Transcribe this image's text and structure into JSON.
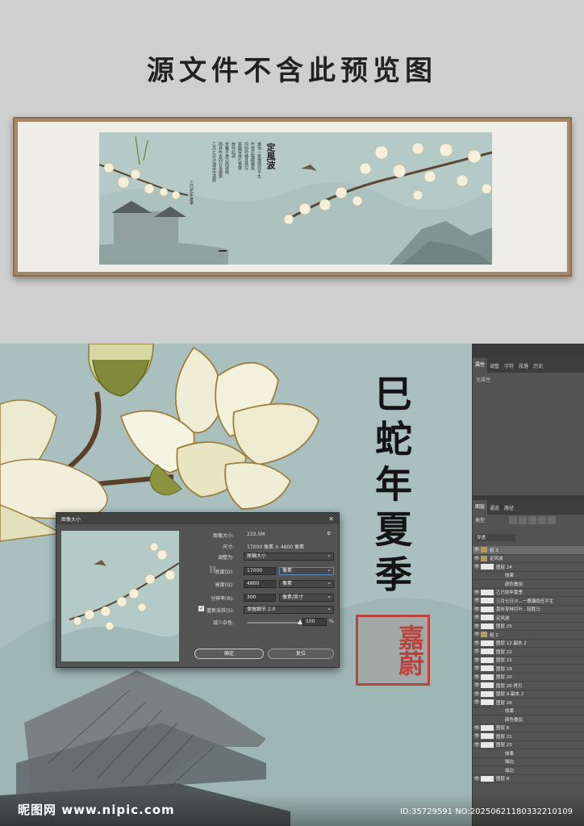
{
  "top": {
    "title": "源文件不含此预览图",
    "poem_title": "定風波",
    "poem_cols": [
      "乙巳蛇年夏季",
      "三月七日沙湖道中遇雨",
      "雨具先去同行皆狼狽",
      "余獨不覺已而遂晴",
      "故作此詞",
      "莫聽穿林打葉聲",
      "何妨吟嘯且徐行",
      "竹杖芒鞋輕勝馬",
      "誰怕一蓑煙雨任平生"
    ]
  },
  "canvas": {
    "calligraphy": "巳蛇年夏季",
    "seal": "嘉蔚"
  },
  "properties_panel": {
    "tabs": [
      "属性",
      "调整",
      "字符",
      "段落",
      "历史"
    ],
    "no_properties": "无属性"
  },
  "layers_panel": {
    "tabs": [
      "图层",
      "通道",
      "路径"
    ],
    "search_placeholder": "类型",
    "blend_mode": "穿透",
    "layers": [
      {
        "name": "组 3",
        "type": "group",
        "selected": true
      },
      {
        "name": "定风波",
        "type": "group"
      },
      {
        "name": "图层 24",
        "type": "layer"
      },
      {
        "name": "效果",
        "type": "fx"
      },
      {
        "name": "颜色叠加",
        "type": "fx"
      },
      {
        "name": "乙巳蛇年夏季",
        "type": "layer"
      },
      {
        "name": "三月七日沙...一蓑烟雨任平生",
        "type": "layer"
      },
      {
        "name": "莫听穿林打叶...轻胜马",
        "type": "layer"
      },
      {
        "name": "定风波",
        "type": "layer"
      },
      {
        "name": "图层 25",
        "type": "layer"
      },
      {
        "name": "组 2",
        "type": "group"
      },
      {
        "name": "图层 12 副本 2",
        "type": "layer"
      },
      {
        "name": "图层 22",
        "type": "layer"
      },
      {
        "name": "图层 15",
        "type": "layer"
      },
      {
        "name": "图层 19",
        "type": "layer"
      },
      {
        "name": "图层 20",
        "type": "layer"
      },
      {
        "name": "图层 20 拷贝",
        "type": "layer"
      },
      {
        "name": "图层 9 副本 2",
        "type": "layer"
      },
      {
        "name": "图层 26",
        "type": "layer"
      },
      {
        "name": "效果",
        "type": "fx"
      },
      {
        "name": "颜色叠加",
        "type": "fx"
      },
      {
        "name": "图层 8",
        "type": "layer"
      },
      {
        "name": "图层 21",
        "type": "layer"
      },
      {
        "name": "图层 23",
        "type": "layer"
      },
      {
        "name": "效果",
        "type": "fx"
      },
      {
        "name": "描边",
        "type": "fx"
      },
      {
        "name": "描边",
        "type": "fx"
      },
      {
        "name": "图层 8",
        "type": "layer"
      }
    ]
  },
  "dialog": {
    "title": "图像大小",
    "image_size_label": "图像大小:",
    "image_size_value": "233.5M",
    "dimensions_label": "尺寸:",
    "dimensions_value": "17000 像素 × 4800 像素",
    "fit_label": "调整为:",
    "fit_value": "原稿大小",
    "width_label": "宽度(D):",
    "width_value": "17000",
    "width_unit": "像素",
    "height_label": "高度(G):",
    "height_value": "4800",
    "height_unit": "像素",
    "resolution_label": "分辨率(R):",
    "resolution_value": "300",
    "resolution_unit": "像素/英寸",
    "resample_label": "重新采样(S):",
    "resample_value": "保留细节 2.0",
    "noise_label": "减少杂色:",
    "noise_value": "100",
    "noise_unit": "%",
    "noise_level": 1.0,
    "ok_label": "确定",
    "cancel_label": "复位"
  },
  "watermark": {
    "site": "昵图网 www.nipic.com",
    "id": "ID:35729591 NO:20250621180332210109"
  },
  "colors": {
    "painting_bg": "#b4cac7",
    "workspace_bg": "#a9c0bf",
    "panel_bg": "#535353",
    "seal_red": "#b8443e"
  }
}
